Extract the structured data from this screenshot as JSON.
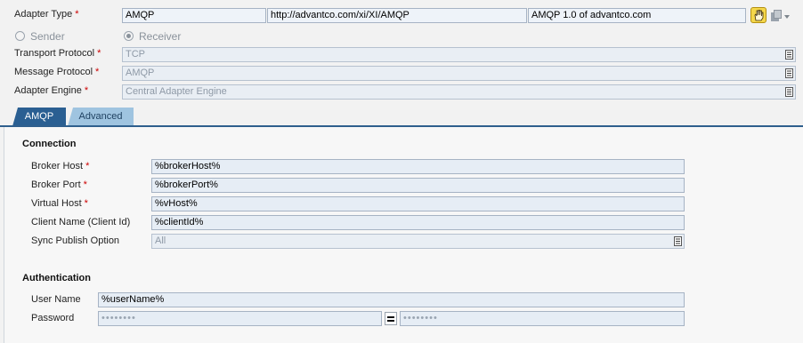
{
  "adapter_type": {
    "label": "Adapter Type",
    "name": "AMQP",
    "namespace": "http://advantco.com/xi/XI/AMQP",
    "swc": "AMQP 1.0 of advantco.com"
  },
  "direction": {
    "sender_label": "Sender",
    "receiver_label": "Receiver",
    "selected": "Receiver"
  },
  "transport_protocol": {
    "label": "Transport Protocol",
    "value": "TCP"
  },
  "message_protocol": {
    "label": "Message Protocol",
    "value": "AMQP"
  },
  "adapter_engine": {
    "label": "Adapter Engine",
    "value": "Central Adapter Engine"
  },
  "tabs": [
    {
      "label": "AMQP",
      "active": true
    },
    {
      "label": "Advanced",
      "active": false
    }
  ],
  "connection": {
    "title": "Connection",
    "broker_host": {
      "label": "Broker Host",
      "value": "%brokerHost%"
    },
    "broker_port": {
      "label": "Broker Port",
      "value": "%brokerPort%"
    },
    "virtual_host": {
      "label": "Virtual Host",
      "value": "%vHost%"
    },
    "client_name": {
      "label": "Client Name (Client Id)",
      "value": "%clientId%"
    },
    "sync_publish": {
      "label": "Sync Publish Option",
      "value": "All"
    }
  },
  "authentication": {
    "title": "Authentication",
    "user_name": {
      "label": "User Name",
      "value": "%userName%"
    },
    "password": {
      "label": "Password",
      "value": "••••••••",
      "confirm": "••••••••"
    }
  },
  "required_marker": "*",
  "icons": [
    "hand-pointer-icon",
    "copy-menu-icon",
    "value-help-icon",
    "equals-icon"
  ],
  "colors": {
    "tab_active": "#2a5f92",
    "tab_inactive": "#9fc4e0",
    "required": "#cc0000",
    "field_bg": "#e6edf5"
  }
}
